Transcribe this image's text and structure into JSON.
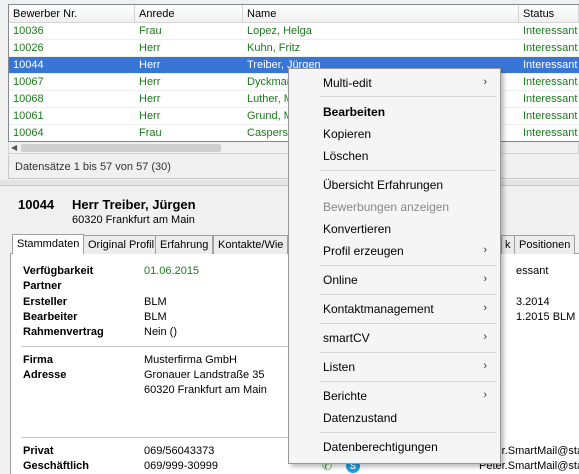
{
  "grid": {
    "columns": [
      "Bewerber Nr.",
      "Anrede",
      "Name",
      "Status"
    ],
    "rows": [
      {
        "nr": "10036",
        "anrede": "Frau",
        "name": "Lopez, Helga",
        "status": "Interessant",
        "selected": false
      },
      {
        "nr": "10026",
        "anrede": "Herr",
        "name": "Kuhn, Fritz",
        "status": "Interessant",
        "selected": false
      },
      {
        "nr": "10044",
        "anrede": "Herr",
        "name": "Treiber, Jürgen",
        "status": "Interessant",
        "selected": true
      },
      {
        "nr": "10067",
        "anrede": "Herr",
        "name": "Dyckman",
        "status": "Interessant",
        "selected": false
      },
      {
        "nr": "10068",
        "anrede": "Herr",
        "name": "Luther, M",
        "status": "Interessant",
        "selected": false
      },
      {
        "nr": "10061",
        "anrede": "Herr",
        "name": "Grund, M",
        "status": "Interessant",
        "selected": false
      },
      {
        "nr": "10064",
        "anrede": "Frau",
        "name": "Caspers -",
        "status": "Interessant",
        "selected": false
      }
    ],
    "records_label": "Datensätze 1 bis 57 von 57 (30)"
  },
  "detail": {
    "id": "10044",
    "name": "Herr Treiber, Jürgen",
    "city": "60320 Frankfurt am Main"
  },
  "tabs": [
    "Stammdaten",
    "Original Profil",
    "Erfahrung",
    "Kontakte/Wie",
    "k",
    "Positionen"
  ],
  "fields": {
    "verfuegbarkeit_label": "Verfügbarkeit",
    "verfuegbarkeit": "01.06.2015",
    "partner_label": "Partner",
    "ersteller_label": "Ersteller",
    "ersteller": "BLM",
    "bearbeiter_label": "Bearbeiter",
    "bearbeiter": "BLM",
    "rahmenvertrag_label": "Rahmenvertrag",
    "rahmenvertrag": "Nein ()",
    "firma_label": "Firma",
    "firma": "Musterfirma GmbH",
    "adresse_label": "Adresse",
    "adresse_line1": "Gronauer Landstraße 35",
    "adresse_line2": "60320 Frankfurt am Main",
    "privat_label": "Privat",
    "privat": "069/56043373",
    "geschaeftlich_label": "Geschäftlich",
    "geschaeftlich": "069/999-30999",
    "right_status": "essant",
    "right_date1": "3.2014",
    "right_date2": "1.2015  BLM",
    "right_mail1": "Peter.SmartMail@staf",
    "right_mail2": "Peter.SmartMail@staf"
  },
  "menu": {
    "multi_edit": "Multi-edit",
    "bearbeiten": "Bearbeiten",
    "kopieren": "Kopieren",
    "loeschen": "Löschen",
    "uebersicht": "Übersicht Erfahrungen",
    "bewerbungen": "Bewerbungen anzeigen",
    "konvertieren": "Konvertieren",
    "profil": "Profil erzeugen",
    "online": "Online",
    "kontaktmanagement": "Kontaktmanagement",
    "smartcv": "smartCV",
    "listen": "Listen",
    "berichte": "Berichte",
    "datenzustand": "Datenzustand",
    "datenberechtigungen": "Datenberechtigungen",
    "submenu_arrow": "›"
  },
  "icons": {
    "phone": "phone-icon",
    "skype": "skype-icon",
    "scroll_left": "scroll-left-arrow-icon"
  },
  "colors": {
    "row_text": "#1b7a1b",
    "selection": "#3875d7",
    "skype": "#1aa0e0"
  }
}
